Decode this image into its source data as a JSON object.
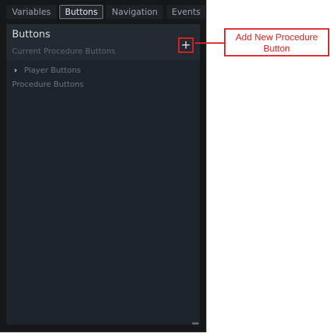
{
  "tabs": [
    {
      "label": "Variables",
      "active": false
    },
    {
      "label": "Buttons",
      "active": true
    },
    {
      "label": "Navigation",
      "active": false
    },
    {
      "label": "Events",
      "active": false
    }
  ],
  "panel": {
    "title": "Buttons",
    "subtitle": "Current Procedure Buttons",
    "add_button_label": "+",
    "player_buttons_label": "Player Buttons",
    "procedure_buttons_label": "Procedure Buttons"
  },
  "annotation": {
    "text_line1": "Add New Procedure",
    "text_line2": "Button",
    "color": "#e22222"
  },
  "icons": {
    "expand": "chevron-right-icon",
    "add": "plus-icon",
    "resize": "resize-grip-icon"
  }
}
